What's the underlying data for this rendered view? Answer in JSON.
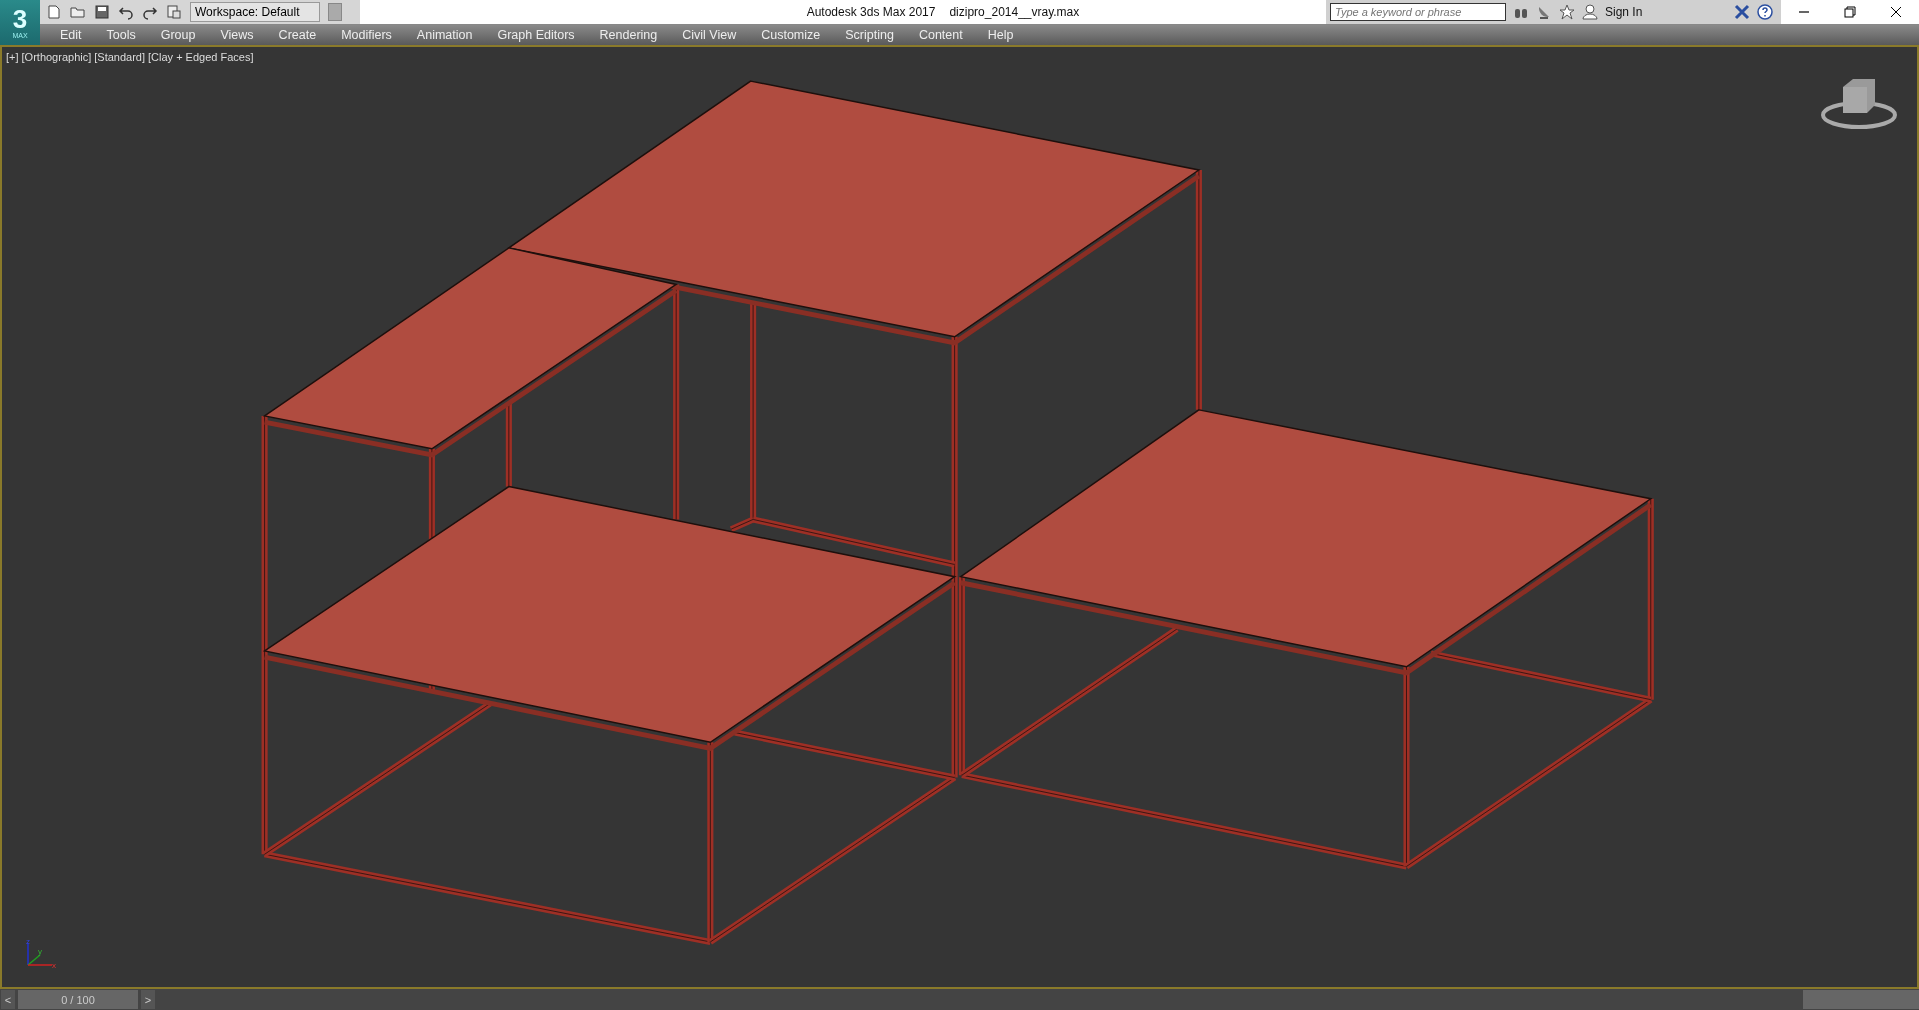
{
  "logo": {
    "mark": "3",
    "caption": "MAX"
  },
  "workspace": {
    "value": "Workspace: Default"
  },
  "window": {
    "app_title": "Autodesk 3ds Max 2017",
    "file_name": "dizipro_2014__vray.max"
  },
  "search": {
    "placeholder": "Type a keyword or phrase"
  },
  "sign_in": "Sign In",
  "menu": [
    "Edit",
    "Tools",
    "Group",
    "Views",
    "Create",
    "Modifiers",
    "Animation",
    "Graph Editors",
    "Rendering",
    "Civil View",
    "Customize",
    "Scripting",
    "Content",
    "Help"
  ],
  "viewport": {
    "labels": [
      "[+]",
      "[Orthographic]",
      "[Standard]",
      "[Clay + Edged Faces]"
    ],
    "axes": {
      "z": "z",
      "y": "y",
      "x": "x"
    }
  },
  "timeline": {
    "prev": "<",
    "frame": "0 / 100",
    "level": 0,
    "next": ">"
  }
}
